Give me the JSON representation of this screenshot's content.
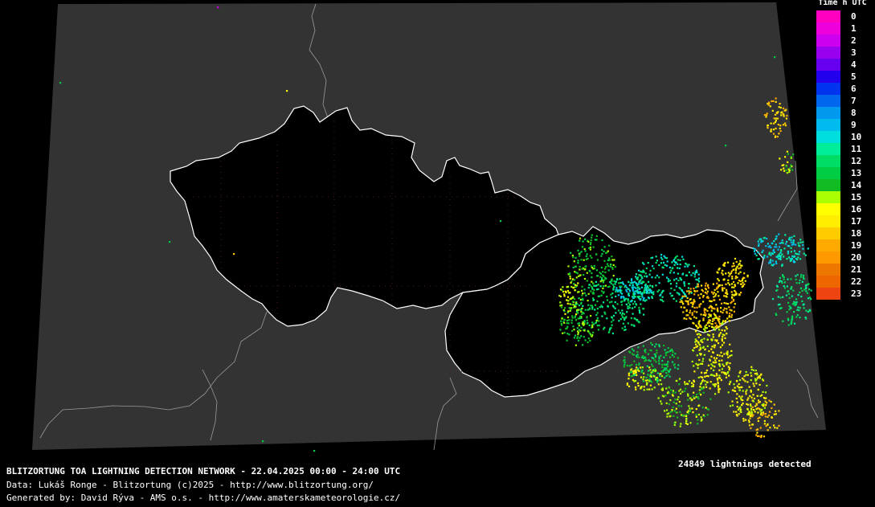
{
  "legend": {
    "title": "Time h UTC",
    "items": [
      {
        "label": "0",
        "color": "#ff00c0"
      },
      {
        "label": "1",
        "color": "#ee00dd"
      },
      {
        "label": "2",
        "color": "#cc00ee"
      },
      {
        "label": "3",
        "color": "#9900ee"
      },
      {
        "label": "4",
        "color": "#6600ee"
      },
      {
        "label": "5",
        "color": "#2200ee"
      },
      {
        "label": "6",
        "color": "#0033ee"
      },
      {
        "label": "7",
        "color": "#0066ee"
      },
      {
        "label": "8",
        "color": "#0099ee"
      },
      {
        "label": "9",
        "color": "#00bbee"
      },
      {
        "label": "10",
        "color": "#00dddd"
      },
      {
        "label": "11",
        "color": "#00ee99"
      },
      {
        "label": "12",
        "color": "#00dd66"
      },
      {
        "label": "13",
        "color": "#00cc44"
      },
      {
        "label": "14",
        "color": "#11bb22"
      },
      {
        "label": "15",
        "color": "#aaff00"
      },
      {
        "label": "16",
        "color": "#ffff00"
      },
      {
        "label": "17",
        "color": "#ffee00"
      },
      {
        "label": "18",
        "color": "#ffcc00"
      },
      {
        "label": "19",
        "color": "#ffaa00"
      },
      {
        "label": "20",
        "color": "#ff9900"
      },
      {
        "label": "21",
        "color": "#ee7700"
      },
      {
        "label": "22",
        "color": "#ee6600"
      },
      {
        "label": "23",
        "color": "#ee4411"
      }
    ]
  },
  "footer": {
    "line1": "BLITZORTUNG TOA LIGHTNING DETECTION NETWORK - 22.04.2025  00:00 - 24:00 UTC",
    "line2": "Data: Lukáš Ronge - Blitzortung (c)2025  -  http://www.blitzortung.org/",
    "line3": "Generated by: David Rýva - AMS o.s.  -  http://www.amaterskameteorologie.cz/"
  },
  "count_text": "24849 lightnings detected",
  "colors": {
    "background": "#000000",
    "map_area": "#333333",
    "country_fill": "#000000",
    "border_main": "#ffffff",
    "border_other": "#9a9a9a"
  }
}
